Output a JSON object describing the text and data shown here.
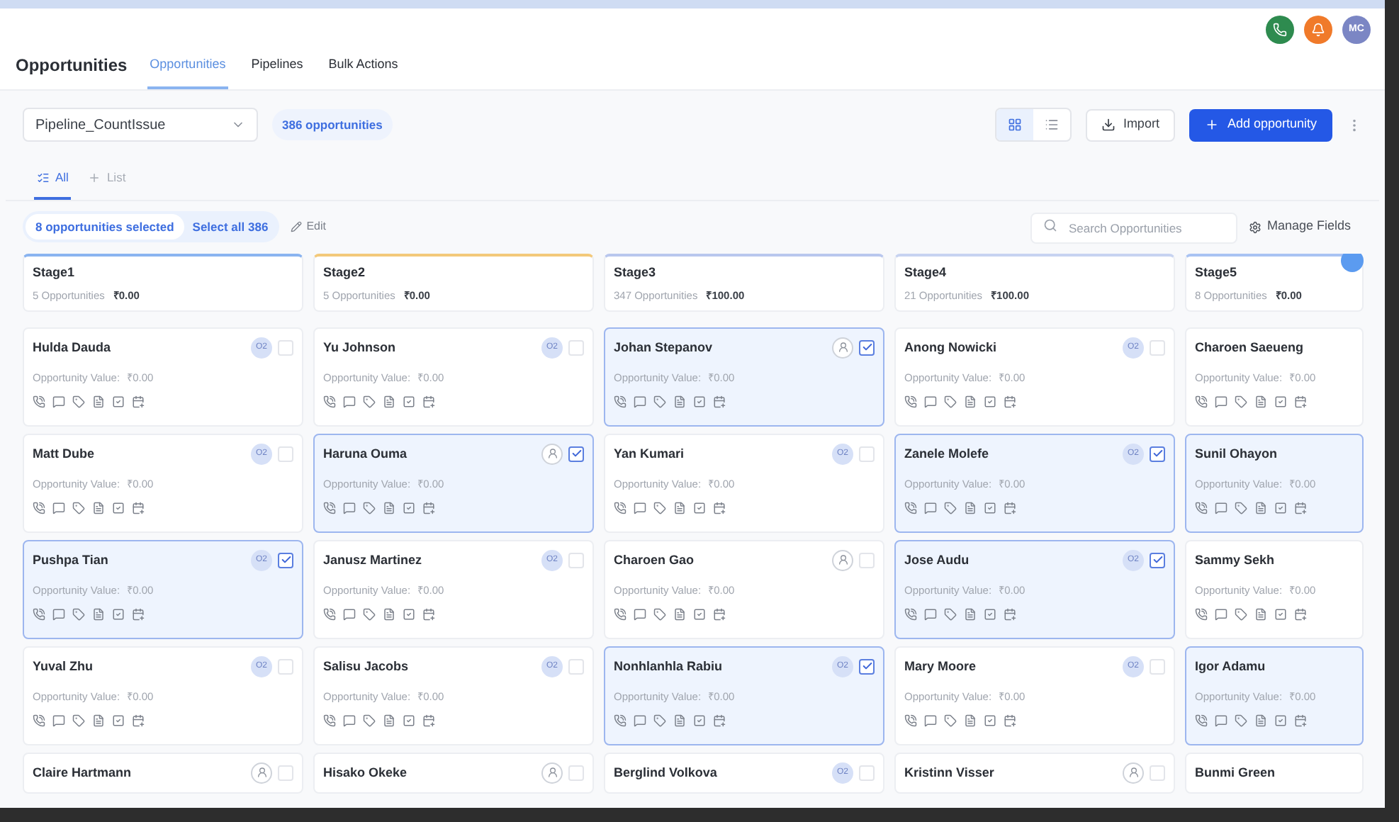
{
  "header": {
    "avatars": [
      {
        "kind": "phone",
        "color": "#2e8b4f"
      },
      {
        "kind": "bell",
        "color": "#f07a2a"
      },
      {
        "kind": "initials",
        "text": "MC",
        "color": "#7b86c4"
      }
    ]
  },
  "nav": {
    "title": "Opportunities",
    "tabs": [
      {
        "label": "Opportunities",
        "selected": true
      },
      {
        "label": "Pipelines",
        "selected": false
      },
      {
        "label": "Bulk Actions",
        "selected": false
      }
    ]
  },
  "toolbar": {
    "pipeline": "Pipeline_CountIssue",
    "count": "386 opportunities",
    "views": [
      {
        "kind": "grid",
        "selected": true
      },
      {
        "kind": "list",
        "selected": false
      }
    ],
    "import": "Import",
    "add": "Add opportunity"
  },
  "view_tabs": [
    {
      "label": "All",
      "kind": "all",
      "selected": true
    },
    {
      "label": "List",
      "kind": "add",
      "selected": false
    }
  ],
  "selection": {
    "selected": "8 opportunities selected",
    "select_all": "Select all 386",
    "edit": "Edit",
    "search_placeholder": "Search Opportunities",
    "manage": "Manage Fields"
  },
  "columns": [
    {
      "stage": "Stage1",
      "count": "5 Opportunities",
      "total": "₹0.00",
      "color": "#8ab4f0",
      "cards": [
        {
          "name": "Hulda Dauda",
          "value_label": "Opportunity Value:",
          "value": "₹0.00",
          "avatar": {
            "kind": "initials",
            "text": "O2"
          },
          "selected": false,
          "checked": false
        },
        {
          "name": "Matt Dube",
          "value_label": "Opportunity Value:",
          "value": "₹0.00",
          "avatar": {
            "kind": "initials",
            "text": "O2"
          },
          "selected": false,
          "checked": false
        },
        {
          "name": "Pushpa Tian",
          "value_label": "Opportunity Value:",
          "value": "₹0.00",
          "avatar": {
            "kind": "initials",
            "text": "O2"
          },
          "selected": true,
          "checked": true
        },
        {
          "name": "Yuval Zhu",
          "value_label": "Opportunity Value:",
          "value": "₹0.00",
          "avatar": {
            "kind": "initials",
            "text": "O2"
          },
          "selected": false,
          "checked": false
        },
        {
          "name": "Claire Hartmann",
          "avatar": {
            "kind": "person"
          },
          "selected": false,
          "checked": false
        }
      ]
    },
    {
      "stage": "Stage2",
      "count": "5 Opportunities",
      "total": "₹0.00",
      "color": "#f3c97a",
      "cards": [
        {
          "name": "Yu Johnson",
          "value_label": "Opportunity Value:",
          "value": "₹0.00",
          "avatar": {
            "kind": "initials",
            "text": "O2"
          },
          "selected": false,
          "checked": false
        },
        {
          "name": "Haruna Ouma",
          "value_label": "Opportunity Value:",
          "value": "₹0.00",
          "avatar": {
            "kind": "person"
          },
          "selected": true,
          "checked": true
        },
        {
          "name": "Janusz Martinez",
          "value_label": "Opportunity Value:",
          "value": "₹0.00",
          "avatar": {
            "kind": "initials",
            "text": "O2"
          },
          "selected": false,
          "checked": false
        },
        {
          "name": "Salisu Jacobs",
          "value_label": "Opportunity Value:",
          "value": "₹0.00",
          "avatar": {
            "kind": "initials",
            "text": "O2"
          },
          "selected": false,
          "checked": false
        },
        {
          "name": "Hisako Okeke",
          "avatar": {
            "kind": "person"
          },
          "selected": false,
          "checked": false
        }
      ]
    },
    {
      "stage": "Stage3",
      "count": "347 Opportunities",
      "total": "₹100.00",
      "color": "#b9c7ee",
      "cards": [
        {
          "name": "Johan Stepanov",
          "value_label": "Opportunity Value:",
          "value": "₹0.00",
          "avatar": {
            "kind": "person"
          },
          "selected": true,
          "checked": true
        },
        {
          "name": "Yan Kumari",
          "value_label": "Opportunity Value:",
          "value": "₹0.00",
          "avatar": {
            "kind": "initials",
            "text": "O2"
          },
          "selected": false,
          "checked": false
        },
        {
          "name": "Charoen Gao",
          "value_label": "Opportunity Value:",
          "value": "₹0.00",
          "avatar": {
            "kind": "person"
          },
          "selected": false,
          "checked": false
        },
        {
          "name": "Nonhlanhla Rabiu",
          "value_label": "Opportunity Value:",
          "value": "₹0.00",
          "avatar": {
            "kind": "initials",
            "text": "O2"
          },
          "selected": true,
          "checked": true
        },
        {
          "name": "Berglind Volkova",
          "avatar": {
            "kind": "initials",
            "text": "O2"
          },
          "selected": false,
          "checked": false
        }
      ]
    },
    {
      "stage": "Stage4",
      "count": "21 Opportunities",
      "total": "₹100.00",
      "color": "#c7d3f1",
      "cards": [
        {
          "name": "Anong Nowicki",
          "value_label": "Opportunity Value:",
          "value": "₹0.00",
          "avatar": {
            "kind": "initials",
            "text": "O2"
          },
          "selected": false,
          "checked": false
        },
        {
          "name": "Zanele Molefe",
          "value_label": "Opportunity Value:",
          "value": "₹0.00",
          "avatar": {
            "kind": "initials",
            "text": "O2"
          },
          "selected": true,
          "checked": true
        },
        {
          "name": "Jose Audu",
          "value_label": "Opportunity Value:",
          "value": "₹0.00",
          "avatar": {
            "kind": "initials",
            "text": "O2"
          },
          "selected": true,
          "checked": true
        },
        {
          "name": "Mary Moore",
          "value_label": "Opportunity Value:",
          "value": "₹0.00",
          "avatar": {
            "kind": "initials",
            "text": "O2"
          },
          "selected": false,
          "checked": false
        },
        {
          "name": "Kristinn Visser",
          "avatar": {
            "kind": "person"
          },
          "selected": false,
          "checked": false
        }
      ]
    },
    {
      "stage": "Stage5",
      "count": "8 Opportunities",
      "total": "₹0.00",
      "color": "#a9c3f3",
      "cards": [
        {
          "name": "Charoen Saeueng",
          "value_label": "Opportunity Value:",
          "value": "₹0.00",
          "selected": false
        },
        {
          "name": "Sunil Ohayon",
          "value_label": "Opportunity Value:",
          "value": "₹0.00",
          "selected": true
        },
        {
          "name": "Sammy Sekh",
          "value_label": "Opportunity Value:",
          "value": "₹0.00",
          "selected": false
        },
        {
          "name": "Igor Adamu",
          "value_label": "Opportunity Value:",
          "value": "₹0.00",
          "selected": true
        },
        {
          "name": "Bunmi Green",
          "selected": false
        }
      ]
    }
  ]
}
